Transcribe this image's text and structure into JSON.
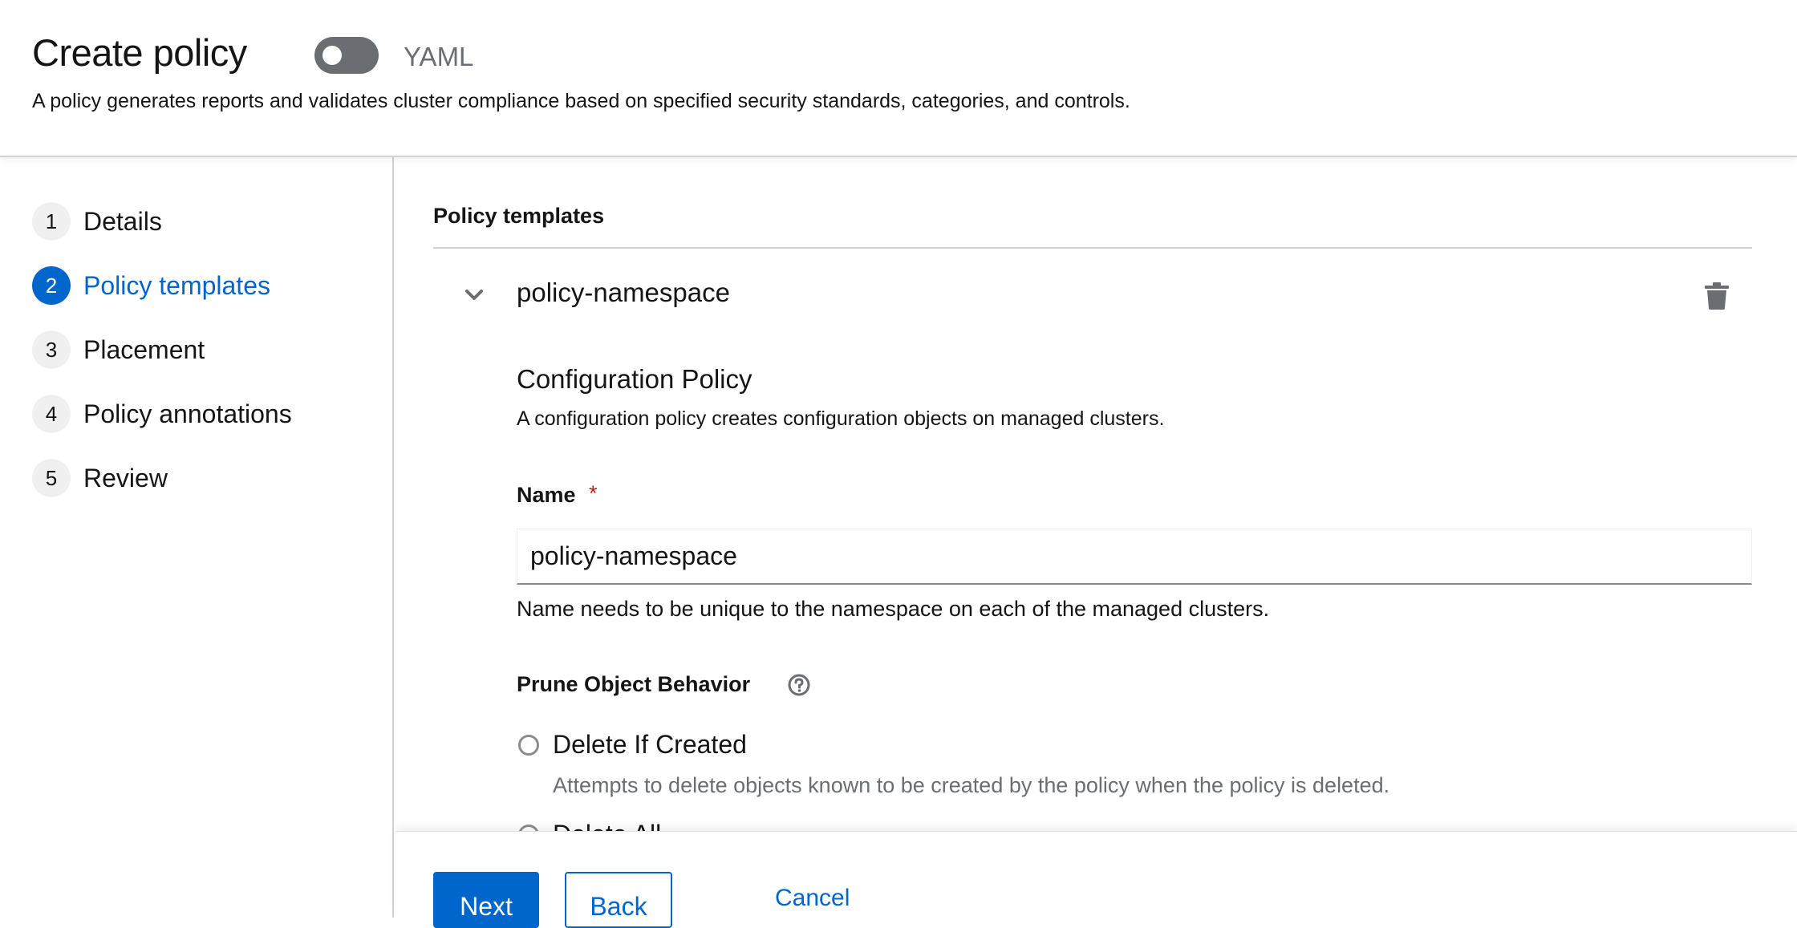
{
  "header": {
    "title": "Create policy",
    "yaml_label": "YAML",
    "description": "A policy generates reports and validates cluster compliance based on specified security standards, categories, and controls."
  },
  "wizard_nav": {
    "steps": [
      {
        "num": "1",
        "label": "Details"
      },
      {
        "num": "2",
        "label": "Policy templates"
      },
      {
        "num": "3",
        "label": "Placement"
      },
      {
        "num": "4",
        "label": "Policy annotations"
      },
      {
        "num": "5",
        "label": "Review"
      }
    ],
    "active_step": 2
  },
  "main": {
    "section_title": "Policy templates",
    "template": {
      "name": "policy-namespace",
      "config_title": "Configuration Policy",
      "config_description": "A configuration policy creates configuration objects on managed clusters.",
      "name_label": "Name",
      "required_marker": "*",
      "name_value": "policy-namespace",
      "name_helper": "Name needs to be unique to the namespace on each of the managed clusters.",
      "prune_label": "Prune Object Behavior",
      "prune_options": [
        {
          "label": "Delete If Created",
          "description": "Attempts to delete objects known to be created by the policy when the policy is deleted."
        },
        {
          "label": "Delete All"
        }
      ]
    }
  },
  "footer": {
    "next_label": "Next",
    "back_label": "Back",
    "cancel_label": "Cancel"
  },
  "colors": {
    "accent": "#0066cc",
    "required": "#c9190b",
    "toggle_off": "#6a6e73"
  },
  "icons": {
    "expand": "chevron-down-icon",
    "delete": "trash-icon",
    "help": "help-circle-icon"
  }
}
